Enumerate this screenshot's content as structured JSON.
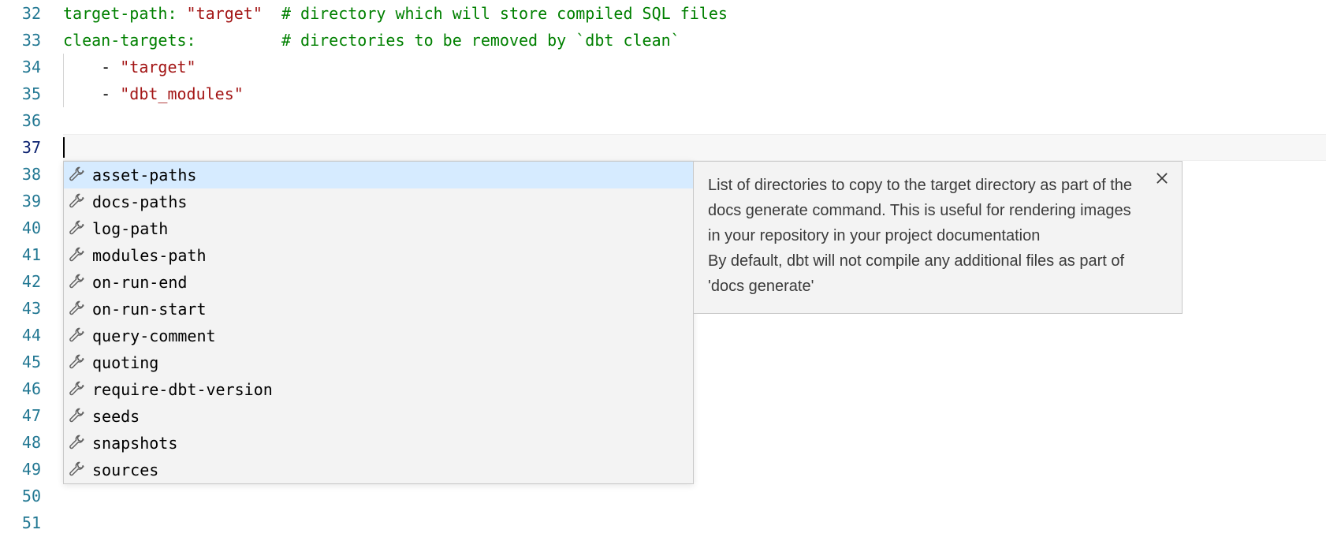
{
  "gutter": {
    "start": 32,
    "end": 51,
    "active": 37
  },
  "code": {
    "line32": {
      "key": "target-path",
      "colon": ":",
      "space1": " ",
      "value": "\"target\"",
      "pad": "  ",
      "comment": "# directory which will store compiled SQL files"
    },
    "line33": {
      "key": "clean-targets",
      "colon": ":",
      "pad": "         ",
      "comment": "# directories to be removed by `dbt clean`"
    },
    "line34": {
      "indent": "    ",
      "dash": "- ",
      "value": "\"target\""
    },
    "line35": {
      "indent": "    ",
      "dash": "- ",
      "value": "\"dbt_modules\""
    }
  },
  "suggestions": [
    {
      "label": "asset-paths",
      "selected": true
    },
    {
      "label": "docs-paths",
      "selected": false
    },
    {
      "label": "log-path",
      "selected": false
    },
    {
      "label": "modules-path",
      "selected": false
    },
    {
      "label": "on-run-end",
      "selected": false
    },
    {
      "label": "on-run-start",
      "selected": false
    },
    {
      "label": "query-comment",
      "selected": false
    },
    {
      "label": "quoting",
      "selected": false
    },
    {
      "label": "require-dbt-version",
      "selected": false
    },
    {
      "label": "seeds",
      "selected": false
    },
    {
      "label": "snapshots",
      "selected": false
    },
    {
      "label": "sources",
      "selected": false
    }
  ],
  "detail": {
    "text": "List of directories to copy to the target directory as part of the docs generate command. This is useful for rendering images in your repository in your project documentation\nBy default, dbt will not compile any additional files as part of 'docs generate'"
  }
}
